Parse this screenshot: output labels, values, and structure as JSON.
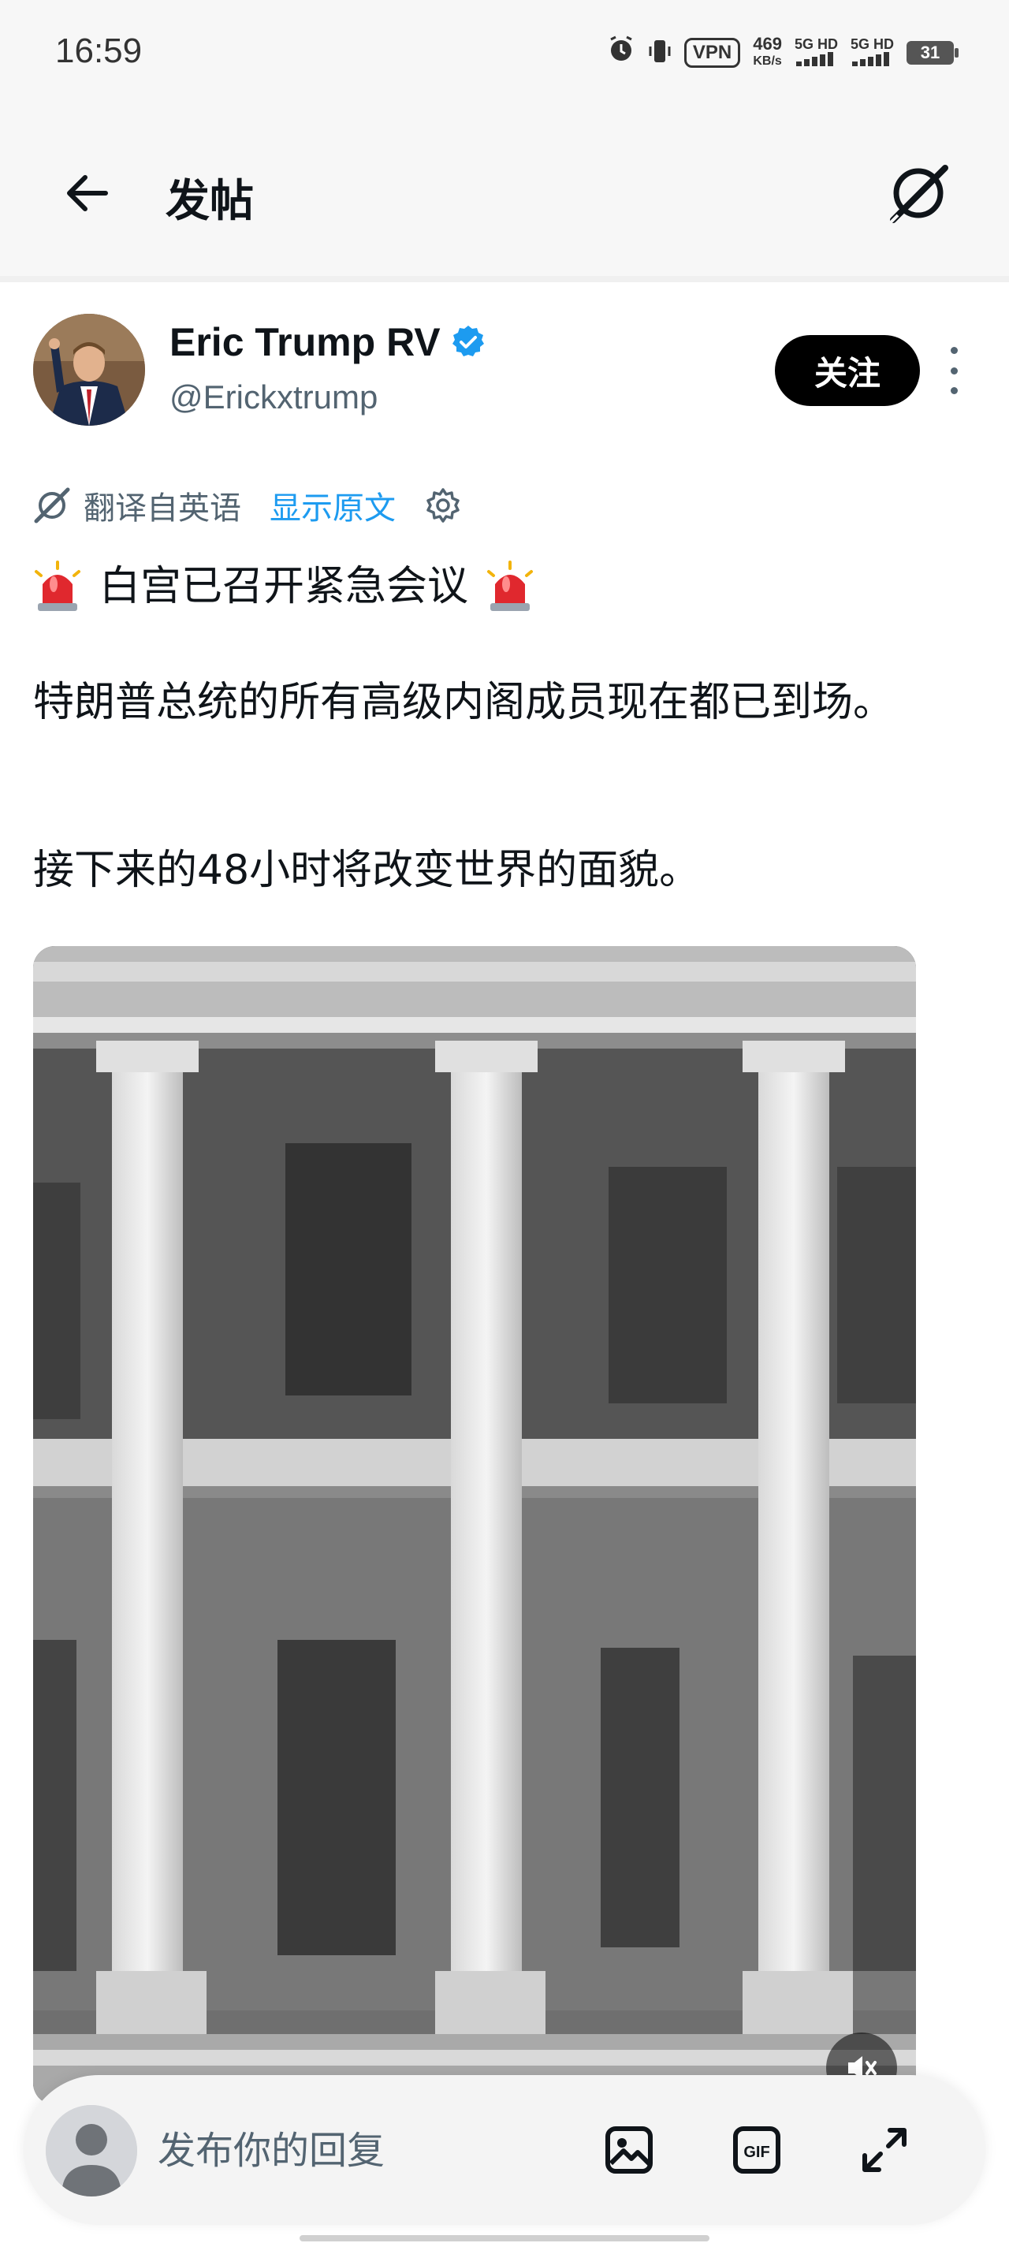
{
  "status_bar": {
    "time": "16:59",
    "vpn": "VPN",
    "speed_value": "469",
    "speed_unit": "KB/s",
    "net1": "5G HD",
    "net2": "5G HD",
    "battery": "31"
  },
  "header": {
    "title": "发帖",
    "back_icon": "arrow-left-icon",
    "right_icon": "grok-icon"
  },
  "post": {
    "author_name": "Eric Trump RV",
    "author_handle": "@Erickxtrump",
    "follow_label": "关注",
    "translation": {
      "label": "翻译自英语",
      "show_original": "显示原文"
    },
    "headline": "白宫已召开紧急会议",
    "paragraph1": "特朗普总统的所有高级内阁成员现在都已到场。",
    "paragraph2": "接下来的48小时将改变世界的面貌。"
  },
  "reply_bar": {
    "placeholder": "发布你的回复"
  },
  "colors": {
    "accent": "#1d9bf0",
    "text": "#0f1419",
    "secondary": "#536471",
    "follow_bg": "#000000"
  }
}
